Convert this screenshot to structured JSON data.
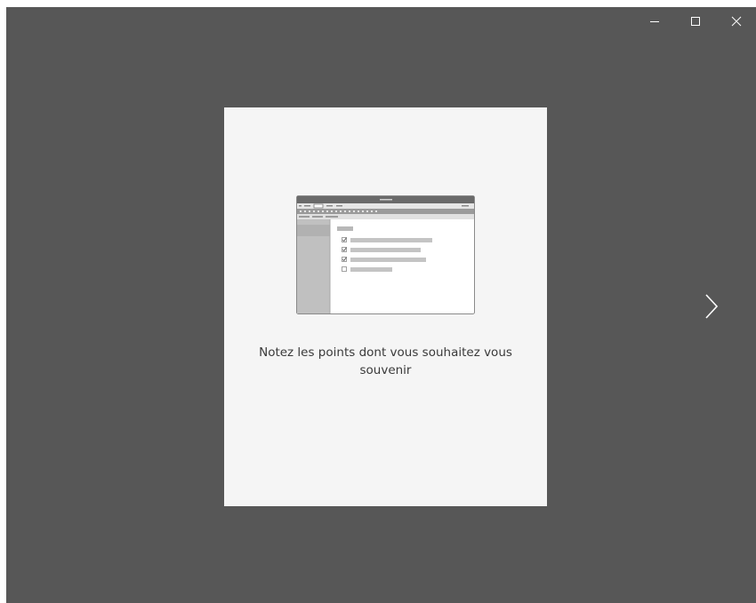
{
  "window": {
    "background_color": "#575757",
    "controls": {
      "minimize_icon": "minimize-icon",
      "maximize_icon": "maximize-icon",
      "close_icon": "close-icon"
    }
  },
  "slide": {
    "illustration_icon": "onenote-checklist-illustration",
    "caption": "Notez les points dont vous souhaitez vous souvenir",
    "background_color": "#f5f5f5"
  },
  "navigation": {
    "next_icon": "chevron-right-icon"
  }
}
